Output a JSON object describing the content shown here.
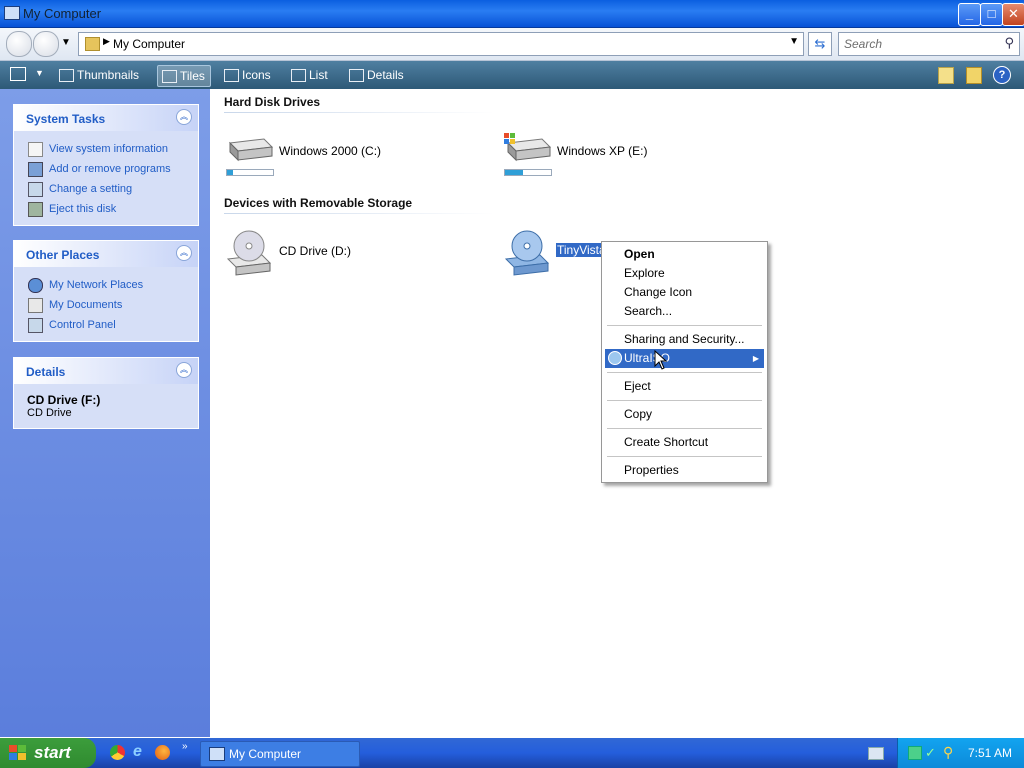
{
  "window": {
    "title": "My Computer",
    "controls": [
      "minimize",
      "maximize",
      "close"
    ]
  },
  "address": {
    "path": "My Computer",
    "search_placeholder": "Search"
  },
  "toolbar": {
    "items": [
      "Thumbnails",
      "Tiles",
      "Icons",
      "List",
      "Details"
    ],
    "active": "Tiles"
  },
  "sidebar": {
    "system_tasks": {
      "title": "System Tasks",
      "items": [
        "View system information",
        "Add or remove programs",
        "Change a setting",
        "Eject this disk"
      ]
    },
    "other_places": {
      "title": "Other Places",
      "items": [
        "My Network Places",
        "My Documents",
        "Control Panel"
      ]
    },
    "details": {
      "title": "Details",
      "name": "CD Drive (F:)",
      "type": "CD Drive"
    }
  },
  "content": {
    "hard_disk_group": "Hard Disk Drives",
    "drives": [
      {
        "label": "Windows 2000 (C:)",
        "used_fraction": 0.12
      },
      {
        "label": "Windows XP (E:)",
        "used_fraction": 0.4
      }
    ],
    "removable_group": "Devices with Removable Storage",
    "removable": [
      {
        "label": "CD Drive (D:)"
      },
      {
        "label": "TinyVista"
      }
    ]
  },
  "context_menu": {
    "items": [
      "Open",
      "Explore",
      "Change Icon",
      "Search...",
      "Sharing and Security...",
      "UltraISO",
      "Eject",
      "Copy",
      "Create Shortcut",
      "Properties"
    ],
    "highlighted": "UltraISO"
  },
  "taskbar": {
    "start": "start",
    "task": "My Computer",
    "clock": "7:51 AM"
  },
  "colors": {
    "sidebar": "#6f8fe2",
    "accent": "#215dc6",
    "highlight": "#3169c6",
    "titlebar": "#0b5fe0"
  }
}
